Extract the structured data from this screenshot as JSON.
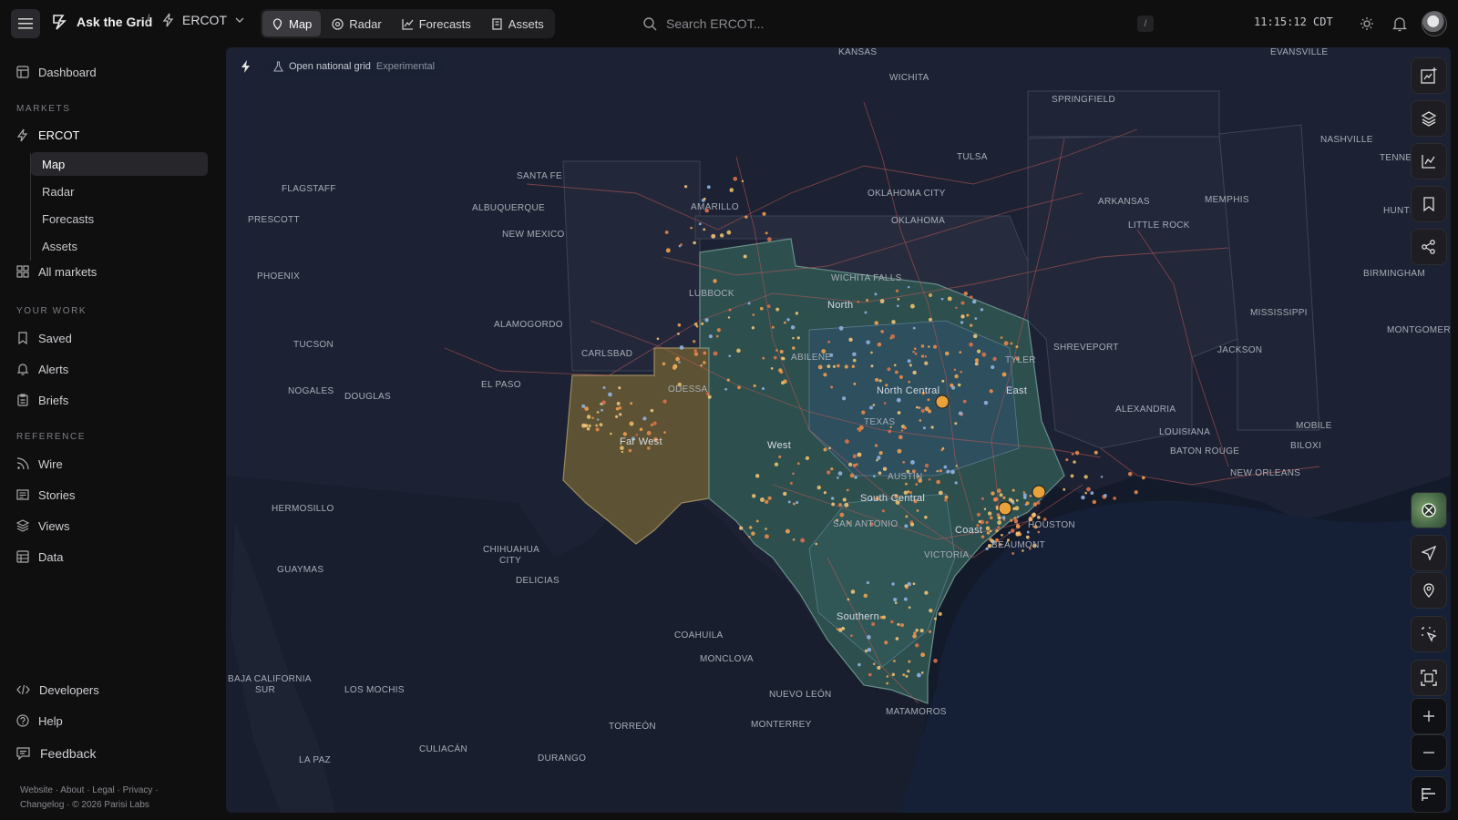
{
  "app": {
    "name": "Ask the Grid",
    "market": "ERCOT",
    "separator": "/"
  },
  "nav": {
    "tabs": [
      {
        "label": "Map",
        "icon": "map-icon",
        "active": true
      },
      {
        "label": "Radar",
        "icon": "radar-icon"
      },
      {
        "label": "Forecasts",
        "icon": "chart-line-icon"
      },
      {
        "label": "Assets",
        "icon": "building-icon"
      }
    ]
  },
  "search": {
    "placeholder": "Search ERCOT...",
    "shortcut": "/"
  },
  "clock": "11:15:12 CDT",
  "sidebar": {
    "dashboard": "Dashboard",
    "markets_label": "MARKETS",
    "ercot": "ERCOT",
    "ercot_sub": [
      "Map",
      "Radar",
      "Forecasts",
      "Assets"
    ],
    "all_markets": "All markets",
    "your_work_label": "YOUR WORK",
    "your_work": [
      "Saved",
      "Alerts",
      "Briefs"
    ],
    "reference_label": "REFERENCE",
    "reference": [
      "Wire",
      "Stories",
      "Views",
      "Data"
    ],
    "bottom": [
      "Developers",
      "Help",
      "Feedback"
    ],
    "footer_line1": "Website · About · Legal · Privacy ·",
    "footer_line2": "Changelog · © 2026 Parisi Labs"
  },
  "map": {
    "toolbar": {
      "grid_label": "Open national grid",
      "experimental": "Experimental"
    },
    "places": [
      "KANSAS",
      "WICHITA",
      "EVANSVILLE",
      "SPRINGFIELD",
      "NASHVILLE",
      "TENNES",
      "TULSA",
      "SANTA FE",
      "FLAGSTAFF",
      "ALBUQUERQUE",
      "AMARILLO",
      "OKLAHOMA CITY",
      "OKLAHOMA",
      "ARKANSAS",
      "MEMPHIS",
      "HUNTSVI",
      "PRESCOTT",
      "NEW MEXICO",
      "LITTLE ROCK",
      "PHOENIX",
      "LUBBOCK",
      "WICHITA FALLS",
      "BIRMINGHAM",
      "ALAMOGORDO",
      "CARLSBAD",
      "ABILENE",
      "MISSISSIPPI",
      "MONTGOMERY",
      "TUCSON",
      "SHREVEPORT",
      "JACKSON",
      "NOGALES",
      "DOUGLAS",
      "EL PASO",
      "ODESSA",
      "TYLER",
      "ALEXANDRIA",
      "MOBILE",
      "TEXAS",
      "LOUISIANA",
      "BATON ROUGE",
      "BILOXI",
      "NEW ORLEANS",
      "HERMOSILLO",
      "AUSTIN",
      "SAN ANTONIO",
      "HOUSTON",
      "BEAUMONT",
      "CHIHUAHUA",
      "CITY",
      "DELICIAS",
      "GUAYMAS",
      "VICTORIA",
      "COAHUILA",
      "MONCLOVA",
      "BAJA CALIFORNIA",
      "SUR",
      "LOS MOCHIS",
      "NUEVO LEÓN",
      "MATAMOROS",
      "MONTERREY",
      "TORREÓN",
      "CULIACÁN",
      "LA PAZ",
      "DURANGO"
    ],
    "zones": [
      "North",
      "North Central",
      "East",
      "Far West",
      "West",
      "South Central",
      "Coast",
      "Southern"
    ],
    "rail_icons": [
      "ai-chart-icon",
      "layers-icon",
      "line-chart-icon",
      "bookmark-icon",
      "share-icon",
      "satellite-thumb-icon",
      "navigate-icon",
      "pin-icon",
      "select-icon",
      "fit-bounds-icon",
      "zoom-in-icon",
      "zoom-out-icon",
      "legend-icon"
    ],
    "colors": {
      "water": "#131a2a",
      "land": "#232839",
      "farwest": "#5d5334",
      "zone": "#2e5250",
      "lines": "#c85a5a",
      "assets": "#f0a050",
      "alert": "#e9a23b"
    }
  }
}
